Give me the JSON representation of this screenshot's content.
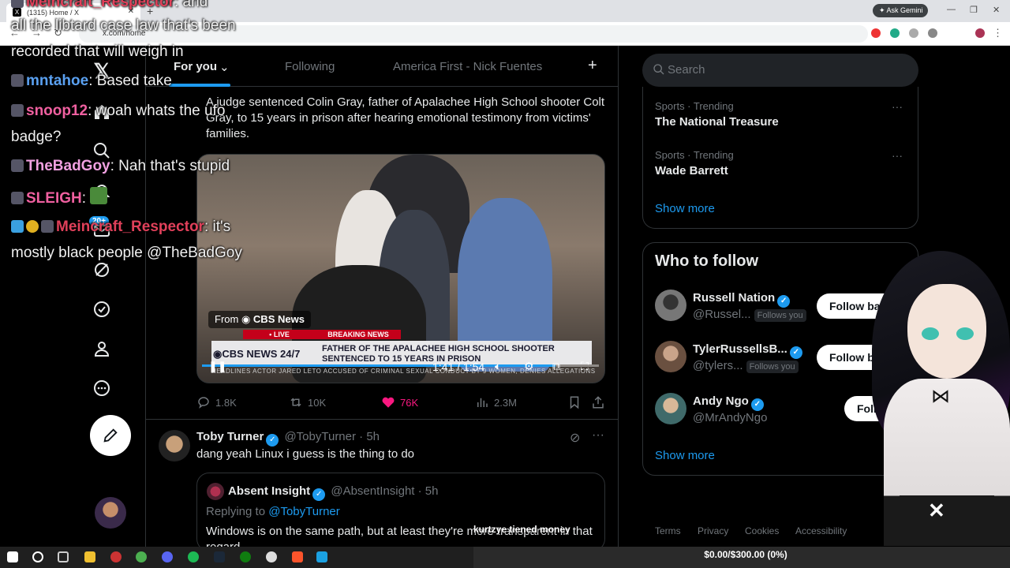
{
  "browser": {
    "tab_title": "(1315) Home / X",
    "url": "x.com/home",
    "ask_gemini": "Ask Gemini"
  },
  "nav": {
    "badge": "20+"
  },
  "timeline": {
    "tabs": [
      "For you",
      "Following",
      "America First - Nick Fuentes"
    ],
    "active_tab": "For you"
  },
  "tweet1": {
    "text": "A judge sentenced Colin Gray, father of Apalachee High School shooter Colt Gray, to 15 years in prison after hearing emotional testimony from victims' families.",
    "video": {
      "from_prefix": "From",
      "from_source": "CBS News",
      "live_label": "• LIVE",
      "breaking_label": "BREAKING NEWS",
      "network": "CBS NEWS 24/7",
      "headline": "FATHER OF THE APALACHEE HIGH SCHOOL SHOOTER SENTENCED TO 15 YEARS IN PRISON",
      "ticker": "HEADLINES  ACTOR JARED LETO ACCUSED OF CRIMINAL SEXUAL CONDUCT BY 9 WOMEN, DENIES ALLEGATIONS",
      "time": "1:41 / 1:54",
      "progress": 0.89
    },
    "stats": {
      "replies": "1.8K",
      "reposts": "10K",
      "likes": "76K",
      "views": "2.3M"
    }
  },
  "tweet2": {
    "name": "Toby Turner",
    "handle": "@TobyTurner",
    "time": "· 5h",
    "text": "dang yeah Linux i guess is the thing to do",
    "quote": {
      "name": "Absent Insight",
      "handle": "@AbsentInsight",
      "time": "· 5h",
      "replying_prefix": "Replying to",
      "replying_to": "@TobyTurner",
      "text": "Windows is on the same path, but at least they're more transparent in that regard"
    }
  },
  "sidebar": {
    "search_placeholder": "Search",
    "trends": [
      {
        "category": "Sports · Trending",
        "name": "The National Treasure"
      },
      {
        "category": "Sports · Trending",
        "name": "Wade Barrett"
      }
    ],
    "show_more": "Show more",
    "who_to_follow_title": "Who to follow",
    "who_to_follow": [
      {
        "name": "Russell Nation",
        "handle": "@Russel...",
        "follows_you": "Follows you",
        "button": "Follow back"
      },
      {
        "name": "TylerRussellsB...",
        "handle": "@tylers...",
        "follows_you": "Follows you",
        "button": "Follow back"
      },
      {
        "name": "Andy Ngo",
        "handle": "@MrAndyNgo",
        "follows_you": "",
        "button": "Follow"
      }
    ],
    "show_more_2": "Show more",
    "footer": [
      "Terms",
      "Privacy",
      "Cookies",
      "Accessibility"
    ]
  },
  "chat": [
    {
      "user": "Meincraft_Respector",
      "msg": ": and"
    },
    {
      "user": "",
      "msg": "all the libtard case law that's been"
    },
    {
      "user": "",
      "msg": "recorded that will weigh in"
    },
    {
      "user": "mntahoe",
      "msg": ": Based take"
    },
    {
      "user": "snoop12",
      "msg": ": woah whats the ufo"
    },
    {
      "user": "",
      "msg": "badge?"
    },
    {
      "user": "TheBadGoy",
      "msg": ": Nah that's stupid"
    },
    {
      "user": "SLEIGH",
      "msg": ":"
    },
    {
      "user": "Meincraft_Respector",
      "msg": ": it's"
    },
    {
      "user": "",
      "msg": "mostly black people @TheBadGoy"
    }
  ],
  "overlay": {
    "caption": "kurtzye tiened money",
    "donation": "$0.00/$300.00 (0%)"
  },
  "colors": {
    "accent": "#1d9bf0",
    "like": "#f91880",
    "background": "#000000"
  }
}
